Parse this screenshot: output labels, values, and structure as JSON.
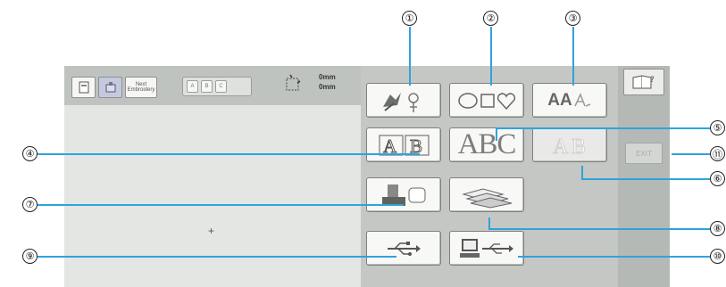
{
  "toolbar": {
    "size_height": "0mm",
    "size_width": "0mm",
    "next_button_label": "Next Embroidery",
    "hoop_slots": [
      "A",
      "B",
      "C"
    ]
  },
  "preview": {
    "center_mark": "+"
  },
  "menu": {
    "text_button_1": "ABC",
    "alphabet_button_glyph": "AA",
    "exit_button": "EXIT"
  },
  "callouts": [
    "①",
    "②",
    "③",
    "④",
    "⑤",
    "⑥",
    "⑦",
    "⑧",
    "⑨",
    "⑩",
    "⑪"
  ]
}
